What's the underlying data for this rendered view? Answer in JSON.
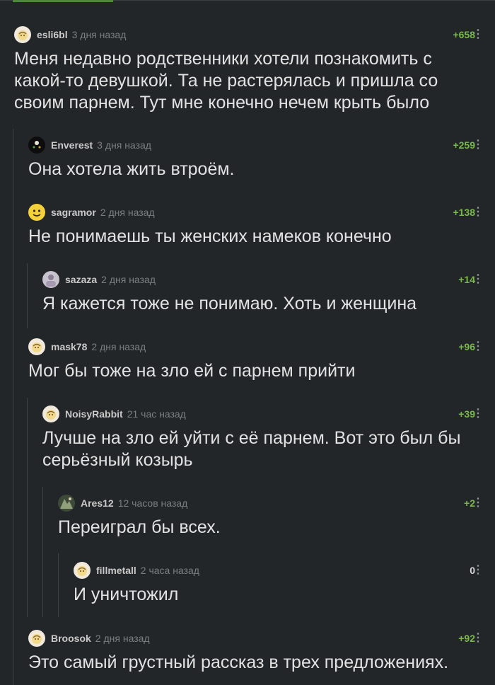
{
  "comments": [
    {
      "user": "esli6bl",
      "time": "3 дня назад",
      "rating": "+658",
      "text": "Меня недавно родственники хотели познакомить с какой-то девушкой. Та не растерялась и пришла со своим парнем. Тут мне конечно нечем крыть было",
      "avatar": "default-avatar-icon"
    },
    {
      "user": "Enverest",
      "time": "3 дня назад",
      "rating": "+259",
      "text": "Она хотела жить втроём.",
      "avatar": "dark-avatar-icon"
    },
    {
      "user": "sagramor",
      "time": "2 дня назад",
      "rating": "+138",
      "text": "Не понимаешь ты женских намеков конечно",
      "avatar": "smiley-avatar-icon"
    },
    {
      "user": "sazaza",
      "time": "2 дня назад",
      "rating": "+14",
      "text": "Я кажется тоже не понимаю. Хоть и женщина",
      "avatar": "photo-avatar-icon"
    },
    {
      "user": "mask78",
      "time": "2 дня назад",
      "rating": "+96",
      "text": "Мог бы тоже на зло ей с парнем прийти",
      "avatar": "default-avatar-icon"
    },
    {
      "user": "NoisyRabbit",
      "time": "21 час назад",
      "rating": "+39",
      "text": "Лучше на зло ей уйти с её парнем. Вот это был бы серьёзный козырь",
      "avatar": "default-avatar-icon"
    },
    {
      "user": "Ares12",
      "time": "12 часов назад",
      "rating": "+2",
      "text": "Переиграл бы всех.",
      "avatar": "photo-avatar-icon"
    },
    {
      "user": "fillmetall",
      "time": "2 часа назад",
      "rating": "0",
      "text": "И уничтожил",
      "avatar": "default-avatar-icon"
    },
    {
      "user": "Broosok",
      "time": "2 дня назад",
      "rating": "+92",
      "text": "Это самый грустный рассказ в трех предложениях.",
      "avatar": "default-avatar-icon"
    }
  ],
  "colors": {
    "background": "#232628",
    "rating_positive": "#78b94a",
    "accent": "#4a8a3a"
  }
}
